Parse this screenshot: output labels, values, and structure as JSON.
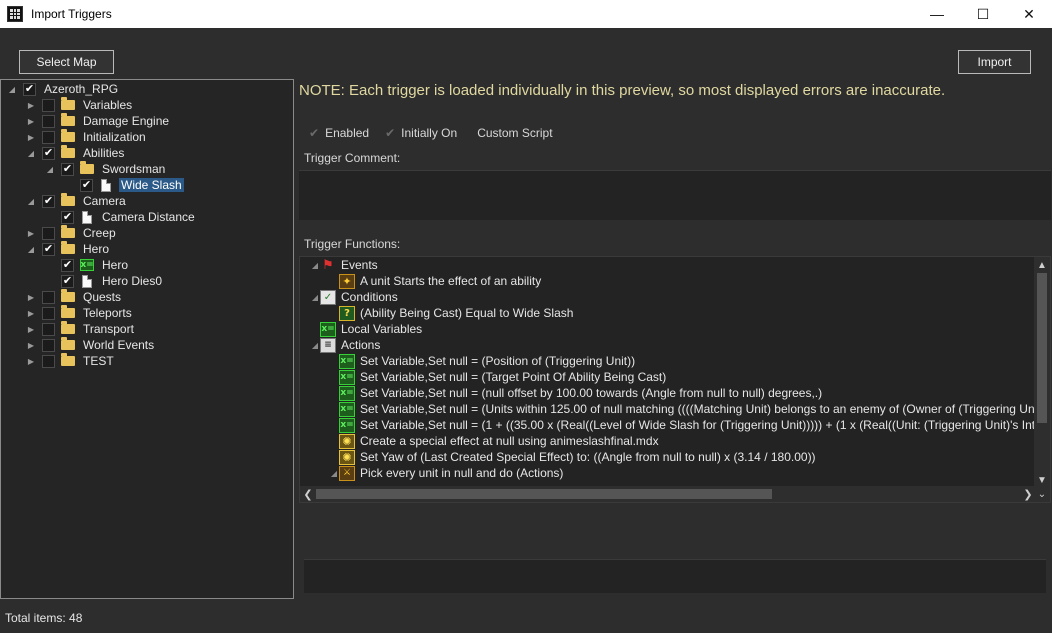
{
  "window": {
    "title": "Import Triggers",
    "minimize": "—",
    "maximize": "☐",
    "close": "✕"
  },
  "toolbar": {
    "select_map_label": "Select Map",
    "import_label": "Import"
  },
  "tree": {
    "items": [
      {
        "label": "Azeroth_RPG",
        "checked": "✔",
        "expander": "◢",
        "icon": "none"
      },
      {
        "label": "Variables",
        "checked": "",
        "expander": "▶",
        "icon": "folder"
      },
      {
        "label": "Damage Engine",
        "checked": "",
        "expander": "▶",
        "icon": "folder"
      },
      {
        "label": "Initialization",
        "checked": "",
        "expander": "▶",
        "icon": "folder"
      },
      {
        "label": "Abilities",
        "checked": "✔",
        "expander": "◢",
        "icon": "folder"
      },
      {
        "label": "Swordsman",
        "checked": "✔",
        "expander": "◢",
        "icon": "folder"
      },
      {
        "label": "Wide Slash",
        "checked": "✔",
        "expander": "",
        "icon": "doc",
        "selected": true
      },
      {
        "label": "Camera",
        "checked": "✔",
        "expander": "◢",
        "icon": "folder"
      },
      {
        "label": "Camera Distance",
        "checked": "✔",
        "expander": "",
        "icon": "doc"
      },
      {
        "label": "Creep",
        "checked": "",
        "expander": "▶",
        "icon": "folder"
      },
      {
        "label": "Hero",
        "checked": "✔",
        "expander": "◢",
        "icon": "folder"
      },
      {
        "label": "Hero",
        "checked": "✔",
        "expander": "",
        "icon": "var"
      },
      {
        "label": "Hero Dies0",
        "checked": "✔",
        "expander": "",
        "icon": "doc"
      },
      {
        "label": "Quests",
        "checked": "",
        "expander": "▶",
        "icon": "folder"
      },
      {
        "label": "Teleports",
        "checked": "",
        "expander": "▶",
        "icon": "folder"
      },
      {
        "label": "Transport",
        "checked": "",
        "expander": "▶",
        "icon": "folder"
      },
      {
        "label": "World Events",
        "checked": "",
        "expander": "▶",
        "icon": "folder"
      },
      {
        "label": "TEST",
        "checked": "",
        "expander": "▶",
        "icon": "folder"
      }
    ]
  },
  "note": "NOTE: Each trigger is loaded individually in this preview, so most displayed errors are inaccurate.",
  "options": {
    "enabled_label": "Enabled",
    "initially_on_label": "Initially On",
    "custom_script_label": "Custom Script",
    "tick": "✔"
  },
  "comment": {
    "label": "Trigger Comment:"
  },
  "functions": {
    "label": "Trigger Functions:",
    "rows": [
      {
        "text": "Events",
        "icon": "event",
        "glyph": "⚑",
        "expander": "◢"
      },
      {
        "text": "A unit Starts the effect of an ability",
        "icon": "ability",
        "glyph": "✦",
        "expander": ""
      },
      {
        "text": "Conditions",
        "icon": "cond",
        "glyph": "✓",
        "expander": "◢"
      },
      {
        "text": "(Ability Being Cast) Equal to Wide Slash",
        "icon": "qmark",
        "glyph": "?",
        "expander": ""
      },
      {
        "text": "Local Variables",
        "icon": "var",
        "glyph": "x=",
        "expander": ""
      },
      {
        "text": "Actions",
        "icon": "actions",
        "glyph": "≡",
        "expander": "◢"
      },
      {
        "text": "Set Variable,Set null = (Position of (Triggering Unit))",
        "icon": "var",
        "glyph": "x=",
        "expander": ""
      },
      {
        "text": "Set Variable,Set null = (Target Point Of Ability Being Cast)",
        "icon": "var",
        "glyph": "x=",
        "expander": ""
      },
      {
        "text": "Set Variable,Set null = (null offset by 100.00 towards (Angle from null to null) degrees,.)",
        "icon": "var",
        "glyph": "x=",
        "expander": ""
      },
      {
        "text": "Set Variable,Set null = (Units within 125.00 of null matching ((((Matching Unit) belongs to an enemy of (Owner of (Triggering Un",
        "icon": "var",
        "glyph": "x=",
        "expander": ""
      },
      {
        "text": "Set Variable,Set null = (1 + ((35.00 x (Real((Level of Wide Slash for (Triggering Unit))))) + (1 x (Real((Unit: (Triggering Unit)'s Intege",
        "icon": "var",
        "glyph": "x=",
        "expander": ""
      },
      {
        "text": "Create a special effect at null using animeslashfinal.mdx",
        "icon": "effect",
        "glyph": "✺",
        "expander": ""
      },
      {
        "text": "Set Yaw of (Last Created Special Effect) to: ((Angle from null to null) x (3.14 / 180.00))",
        "icon": "effect",
        "glyph": "✺",
        "expander": ""
      },
      {
        "text": "Pick every unit in null and do (Actions)",
        "icon": "pick",
        "glyph": "⚔",
        "expander": "◢"
      }
    ]
  },
  "scroll": {
    "up": "▲",
    "down": "▼",
    "left": "❮",
    "right": "❯",
    "corner": "⌄"
  },
  "status": "Total items: 48"
}
